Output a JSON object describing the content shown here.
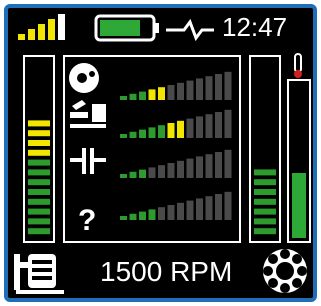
{
  "status_bar": {
    "signal_icon": "signal-strength-icon",
    "signal_bars_lit": 4,
    "signal_bars_total": 5,
    "battery_icon": "battery-icon",
    "battery_level": 0.8,
    "waveform_icon": "vibration-waveform-icon",
    "time": "12:47"
  },
  "left_gauge": {
    "name": "overall-level",
    "level_lit": 12,
    "total": 18,
    "colors": [
      "#2e9b2e",
      "#f2e600"
    ]
  },
  "right_gauges": [
    {
      "name": "temperature-level",
      "level": 0.38
    },
    {
      "name": "thermometer-level",
      "level": 0.42,
      "icon": "thermometer-icon"
    }
  ],
  "fault_rows": [
    {
      "icon": "unbalance-icon",
      "lit": 5,
      "total": 12,
      "highlight": "#f2e600"
    },
    {
      "icon": "misalignment-icon",
      "lit": 7,
      "total": 12,
      "highlight": "#f2e600"
    },
    {
      "icon": "looseness-icon",
      "lit": 3,
      "total": 12,
      "highlight": "#2e9b2e"
    },
    {
      "icon": "unknown-fault-icon",
      "lit": 4,
      "total": 12,
      "highlight": "#2e9b2e"
    }
  ],
  "footer": {
    "machine_icon": "motor-pump-icon",
    "rpm_label": "1500 RPM",
    "bearing_icon": "bearing-icon"
  }
}
